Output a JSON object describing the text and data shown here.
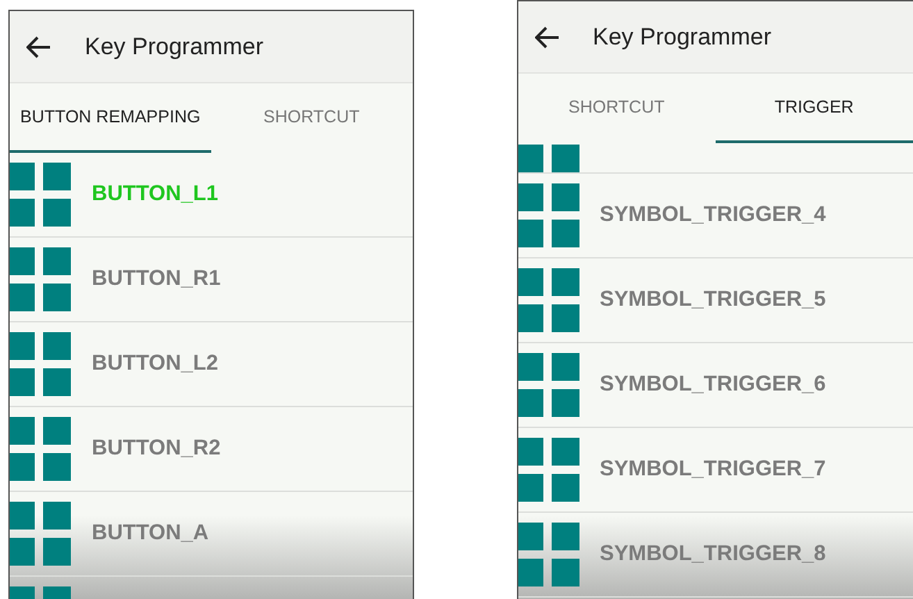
{
  "screens": [
    {
      "title": "Key Programmer",
      "tabs": [
        {
          "label": "BUTTON REMAPPING",
          "selected": true
        },
        {
          "label": "SHORTCUT",
          "selected": false
        }
      ],
      "rows": [
        {
          "kind": "entry",
          "label": "BUTTON_L1",
          "highlighted": true
        },
        {
          "kind": "entry",
          "label": "BUTTON_R1",
          "highlighted": false
        },
        {
          "kind": "entry",
          "label": "BUTTON_L2",
          "highlighted": false
        },
        {
          "kind": "entry",
          "label": "BUTTON_R2",
          "highlighted": false
        },
        {
          "kind": "entry",
          "label": "BUTTON_A",
          "highlighted": false
        },
        {
          "kind": "cut_bottom"
        }
      ]
    },
    {
      "title": "Key Programmer",
      "tabs": [
        {
          "label": "SHORTCUT",
          "selected": false
        },
        {
          "label": "TRIGGER",
          "selected": true
        }
      ],
      "rows": [
        {
          "kind": "cut_top"
        },
        {
          "kind": "entry",
          "label": "SYMBOL_TRIGGER_4",
          "highlighted": false
        },
        {
          "kind": "entry",
          "label": "SYMBOL_TRIGGER_5",
          "highlighted": false
        },
        {
          "kind": "entry",
          "label": "SYMBOL_TRIGGER_6",
          "highlighted": false
        },
        {
          "kind": "entry",
          "label": "SYMBOL_TRIGGER_7",
          "highlighted": false
        },
        {
          "kind": "entry",
          "label": "SYMBOL_TRIGGER_8",
          "highlighted": false
        }
      ]
    }
  ]
}
